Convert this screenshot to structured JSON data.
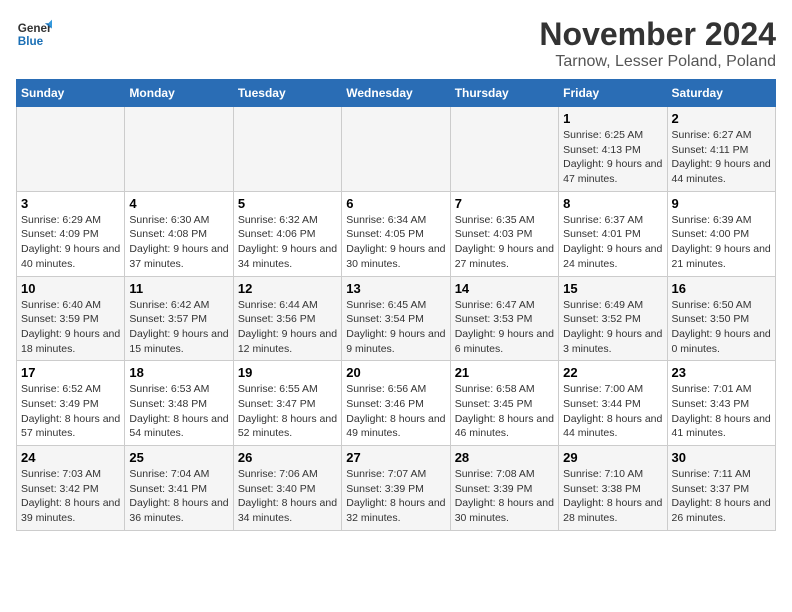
{
  "logo": {
    "line1": "General",
    "line2": "Blue"
  },
  "title": {
    "month_year": "November 2024",
    "location": "Tarnow, Lesser Poland, Poland"
  },
  "headers": [
    "Sunday",
    "Monday",
    "Tuesday",
    "Wednesday",
    "Thursday",
    "Friday",
    "Saturday"
  ],
  "weeks": [
    [
      {
        "day": "",
        "info": ""
      },
      {
        "day": "",
        "info": ""
      },
      {
        "day": "",
        "info": ""
      },
      {
        "day": "",
        "info": ""
      },
      {
        "day": "",
        "info": ""
      },
      {
        "day": "1",
        "info": "Sunrise: 6:25 AM\nSunset: 4:13 PM\nDaylight: 9 hours and 47 minutes."
      },
      {
        "day": "2",
        "info": "Sunrise: 6:27 AM\nSunset: 4:11 PM\nDaylight: 9 hours and 44 minutes."
      }
    ],
    [
      {
        "day": "3",
        "info": "Sunrise: 6:29 AM\nSunset: 4:09 PM\nDaylight: 9 hours and 40 minutes."
      },
      {
        "day": "4",
        "info": "Sunrise: 6:30 AM\nSunset: 4:08 PM\nDaylight: 9 hours and 37 minutes."
      },
      {
        "day": "5",
        "info": "Sunrise: 6:32 AM\nSunset: 4:06 PM\nDaylight: 9 hours and 34 minutes."
      },
      {
        "day": "6",
        "info": "Sunrise: 6:34 AM\nSunset: 4:05 PM\nDaylight: 9 hours and 30 minutes."
      },
      {
        "day": "7",
        "info": "Sunrise: 6:35 AM\nSunset: 4:03 PM\nDaylight: 9 hours and 27 minutes."
      },
      {
        "day": "8",
        "info": "Sunrise: 6:37 AM\nSunset: 4:01 PM\nDaylight: 9 hours and 24 minutes."
      },
      {
        "day": "9",
        "info": "Sunrise: 6:39 AM\nSunset: 4:00 PM\nDaylight: 9 hours and 21 minutes."
      }
    ],
    [
      {
        "day": "10",
        "info": "Sunrise: 6:40 AM\nSunset: 3:59 PM\nDaylight: 9 hours and 18 minutes."
      },
      {
        "day": "11",
        "info": "Sunrise: 6:42 AM\nSunset: 3:57 PM\nDaylight: 9 hours and 15 minutes."
      },
      {
        "day": "12",
        "info": "Sunrise: 6:44 AM\nSunset: 3:56 PM\nDaylight: 9 hours and 12 minutes."
      },
      {
        "day": "13",
        "info": "Sunrise: 6:45 AM\nSunset: 3:54 PM\nDaylight: 9 hours and 9 minutes."
      },
      {
        "day": "14",
        "info": "Sunrise: 6:47 AM\nSunset: 3:53 PM\nDaylight: 9 hours and 6 minutes."
      },
      {
        "day": "15",
        "info": "Sunrise: 6:49 AM\nSunset: 3:52 PM\nDaylight: 9 hours and 3 minutes."
      },
      {
        "day": "16",
        "info": "Sunrise: 6:50 AM\nSunset: 3:50 PM\nDaylight: 9 hours and 0 minutes."
      }
    ],
    [
      {
        "day": "17",
        "info": "Sunrise: 6:52 AM\nSunset: 3:49 PM\nDaylight: 8 hours and 57 minutes."
      },
      {
        "day": "18",
        "info": "Sunrise: 6:53 AM\nSunset: 3:48 PM\nDaylight: 8 hours and 54 minutes."
      },
      {
        "day": "19",
        "info": "Sunrise: 6:55 AM\nSunset: 3:47 PM\nDaylight: 8 hours and 52 minutes."
      },
      {
        "day": "20",
        "info": "Sunrise: 6:56 AM\nSunset: 3:46 PM\nDaylight: 8 hours and 49 minutes."
      },
      {
        "day": "21",
        "info": "Sunrise: 6:58 AM\nSunset: 3:45 PM\nDaylight: 8 hours and 46 minutes."
      },
      {
        "day": "22",
        "info": "Sunrise: 7:00 AM\nSunset: 3:44 PM\nDaylight: 8 hours and 44 minutes."
      },
      {
        "day": "23",
        "info": "Sunrise: 7:01 AM\nSunset: 3:43 PM\nDaylight: 8 hours and 41 minutes."
      }
    ],
    [
      {
        "day": "24",
        "info": "Sunrise: 7:03 AM\nSunset: 3:42 PM\nDaylight: 8 hours and 39 minutes."
      },
      {
        "day": "25",
        "info": "Sunrise: 7:04 AM\nSunset: 3:41 PM\nDaylight: 8 hours and 36 minutes."
      },
      {
        "day": "26",
        "info": "Sunrise: 7:06 AM\nSunset: 3:40 PM\nDaylight: 8 hours and 34 minutes."
      },
      {
        "day": "27",
        "info": "Sunrise: 7:07 AM\nSunset: 3:39 PM\nDaylight: 8 hours and 32 minutes."
      },
      {
        "day": "28",
        "info": "Sunrise: 7:08 AM\nSunset: 3:39 PM\nDaylight: 8 hours and 30 minutes."
      },
      {
        "day": "29",
        "info": "Sunrise: 7:10 AM\nSunset: 3:38 PM\nDaylight: 8 hours and 28 minutes."
      },
      {
        "day": "30",
        "info": "Sunrise: 7:11 AM\nSunset: 3:37 PM\nDaylight: 8 hours and 26 minutes."
      }
    ]
  ]
}
